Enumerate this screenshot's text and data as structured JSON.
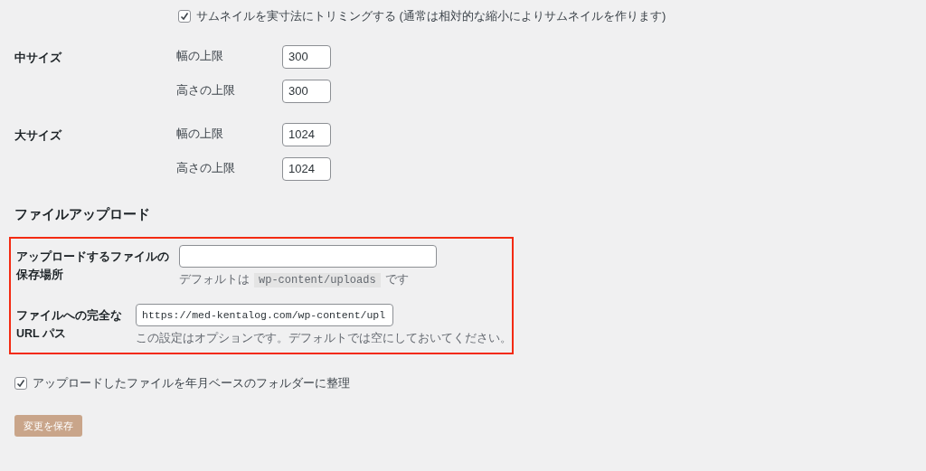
{
  "thumbnail_crop": {
    "label": "サムネイルを実寸法にトリミングする (通常は相対的な縮小によりサムネイルを作ります)",
    "checked": true
  },
  "size_groups": [
    {
      "title": "中サイズ",
      "fields": [
        {
          "label": "幅の上限",
          "value": "300"
        },
        {
          "label": "高さの上限",
          "value": "300"
        }
      ]
    },
    {
      "title": "大サイズ",
      "fields": [
        {
          "label": "幅の上限",
          "value": "1024"
        },
        {
          "label": "高さの上限",
          "value": "1024"
        }
      ]
    }
  ],
  "upload_section": {
    "heading": "ファイルアップロード",
    "highlighted": true,
    "rows": [
      {
        "label": "アップロードするファイルの保存場所",
        "value": "",
        "description": {
          "before": "デフォルトは",
          "code": "wp-content/uploads",
          "after": "です"
        }
      },
      {
        "label": "ファイルへの完全な URL パス",
        "value": "https://med-kentalog.com/wp-content/upl",
        "description": {
          "before": "この設定はオプションです。デフォルトでは空にしておいてください。"
        }
      }
    ]
  },
  "organize_folders": {
    "label": "アップロードしたファイルを年月ベースのフォルダーに整理",
    "checked": true
  },
  "save_button": "変更を保存"
}
